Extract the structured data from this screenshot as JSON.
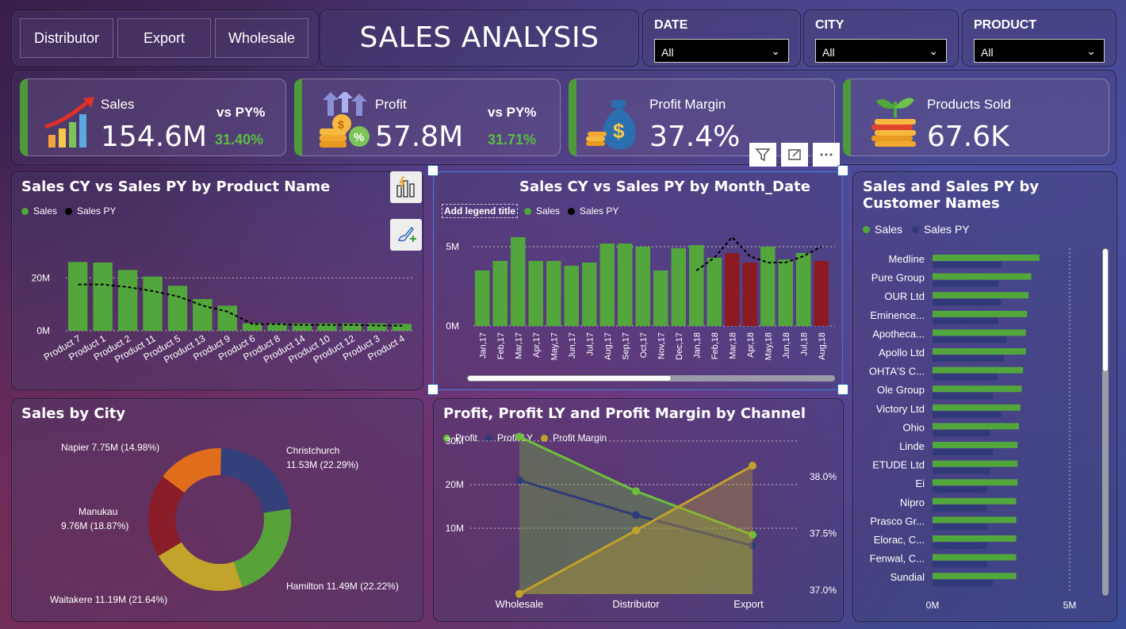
{
  "buttons": [
    "Distributor",
    "Export",
    "Wholesale"
  ],
  "title": "SALES ANALYSIS",
  "filters": [
    {
      "label": "DATE",
      "value": "All"
    },
    {
      "label": "CITY",
      "value": "All"
    },
    {
      "label": "PRODUCT",
      "value": "All"
    }
  ],
  "kpis": [
    {
      "name": "Sales",
      "value": "154.6M",
      "vs_label": "vs PY%",
      "pct": "31.40%"
    },
    {
      "name": "Profit",
      "value": "57.8M",
      "vs_label": "vs PY%",
      "pct": "31.71%"
    },
    {
      "name": "Profit Margin",
      "value": "37.4%"
    },
    {
      "name": "Products Sold",
      "value": "67.6K"
    }
  ],
  "legend_labels": {
    "sales": "Sales",
    "sales_py": "Sales PY",
    "profit": "Profit",
    "profit_ly": "Profit LY",
    "profit_margin": "Profit Margin",
    "add_legend_title": "Add legend title"
  },
  "colors": {
    "sales": "#52a63c",
    "sales_py": "#000000",
    "highlight": "#8b1a22",
    "profit": "#6cbf3a",
    "profit_ly": "#303a78",
    "profit_margin": "#c2a02c"
  },
  "chart_data": [
    {
      "id": "product",
      "type": "bar",
      "title": "Sales CY vs Sales PY by Product Name",
      "categories": [
        "Product 7",
        "Product 1",
        "Product 2",
        "Product 11",
        "Product 5",
        "Product 13",
        "Product 9",
        "Product 6",
        "Product 8",
        "Product 14",
        "Product 10",
        "Product 12",
        "Product 3",
        "Product 4"
      ],
      "series": [
        {
          "name": "Sales",
          "values": [
            26,
            25.8,
            23,
            20.5,
            17,
            12,
            9.5,
            2.8,
            2.8,
            2.8,
            2.8,
            2.8,
            2.8,
            2.6
          ]
        },
        {
          "name": "Sales PY",
          "values": [
            17.5,
            17.5,
            16.5,
            15,
            13,
            9.5,
            7.2,
            2.5,
            2.5,
            2.2,
            2.2,
            2.2,
            2.0,
            1.9
          ]
        }
      ],
      "yticks": [
        "0M",
        "20M"
      ],
      "ylim": [
        0,
        30
      ]
    },
    {
      "id": "month",
      "type": "bar",
      "title": "Sales CY vs Sales PY by Month_Date",
      "categories": [
        "Jan,17",
        "Feb,17",
        "Mar,17",
        "Apr,17",
        "May,17",
        "Jun,17",
        "Jul,17",
        "Aug,17",
        "Sep,17",
        "Oct,17",
        "Nov,17",
        "Dec,17",
        "Jan,18",
        "Feb,18",
        "Mar,18",
        "Apr,18",
        "May,18",
        "Jun,18",
        "Jul,18",
        "Aug,18"
      ],
      "series": [
        {
          "name": "Sales",
          "values": [
            3.5,
            4.1,
            5.6,
            4.1,
            4.1,
            3.8,
            4.0,
            5.2,
            5.2,
            5.0,
            3.5,
            4.9,
            5.1,
            4.3,
            4.6,
            4.0,
            5.0,
            4.2,
            4.6,
            4.1
          ]
        },
        {
          "name": "Sales PY",
          "values": [
            null,
            null,
            null,
            null,
            null,
            null,
            null,
            null,
            null,
            null,
            null,
            null,
            3.5,
            4.3,
            5.6,
            4.4,
            4.0,
            4.0,
            4.4,
            5.0
          ]
        }
      ],
      "highlight_indices": [
        14,
        15,
        19
      ],
      "yticks": [
        "0M",
        "5M"
      ],
      "ylim": [
        0,
        6
      ]
    },
    {
      "id": "customer",
      "type": "bar",
      "title": "Sales and Sales PY by Customer Names",
      "categories": [
        "Medline",
        "Pure Group",
        "OUR Ltd",
        "Eminence...",
        "Apotheca...",
        "Apollo Ltd",
        "OHTA'S C...",
        "Ole Group",
        "Victory Ltd",
        "Ohio",
        "Linde",
        "ETUDE Ltd",
        "Ei",
        "Nipro",
        "Prasco Gr...",
        "Elorac, C...",
        "Fenwal, C...",
        "Sundial"
      ],
      "series": [
        {
          "name": "Sales",
          "values": [
            3.9,
            3.6,
            3.5,
            3.45,
            3.4,
            3.4,
            3.3,
            3.25,
            3.2,
            3.15,
            3.1,
            3.1,
            3.1,
            3.05,
            3.05,
            3.05,
            3.05,
            3.05
          ]
        },
        {
          "name": "Sales PY",
          "values": [
            2.5,
            2.4,
            2.5,
            2.4,
            2.7,
            2.6,
            2.4,
            2.2,
            2.5,
            2.1,
            2.2,
            2.1,
            2.0,
            2.0,
            2.0,
            2.0,
            2.0,
            2.2
          ]
        }
      ],
      "xticks": [
        "0M",
        "5M"
      ],
      "xlim": [
        0,
        5
      ]
    },
    {
      "id": "city",
      "type": "pie",
      "title": "Sales by City",
      "slices": [
        {
          "label": "Christchurch 11.53M (22.29%)",
          "value": 22.29,
          "color": "#33407a"
        },
        {
          "label": "Hamilton 11.49M (22.22%)",
          "value": 22.22,
          "color": "#57a33a"
        },
        {
          "label": "Waitakere 11.19M (21.64%)",
          "value": 21.64,
          "color": "#c2a32b"
        },
        {
          "label": "Manukau 9.76M (18.87%)",
          "value": 18.87,
          "color": "#8a1e28"
        },
        {
          "label": "Napier 7.75M (14.98%)",
          "value": 14.98,
          "color": "#e06d1b"
        }
      ]
    },
    {
      "id": "channel",
      "type": "line",
      "title": "Profit, Profit LY and Profit Margin by Channel",
      "categories": [
        "Wholesale",
        "Distributor",
        "Export"
      ],
      "series": [
        {
          "name": "Profit",
          "values": [
            31,
            18.5,
            8.5
          ]
        },
        {
          "name": "Profit LY",
          "values": [
            21,
            13,
            6
          ]
        },
        {
          "name": "Profit Margin",
          "values": [
            36.96,
            37.52,
            38.09
          ]
        }
      ],
      "yticks": [
        "10M",
        "20M",
        "30M"
      ],
      "ylim": [
        0,
        40
      ],
      "y2ticks": [
        "37.0%",
        "37.5%",
        "38.0%"
      ],
      "y2lim": [
        36.9,
        38.2
      ]
    }
  ]
}
